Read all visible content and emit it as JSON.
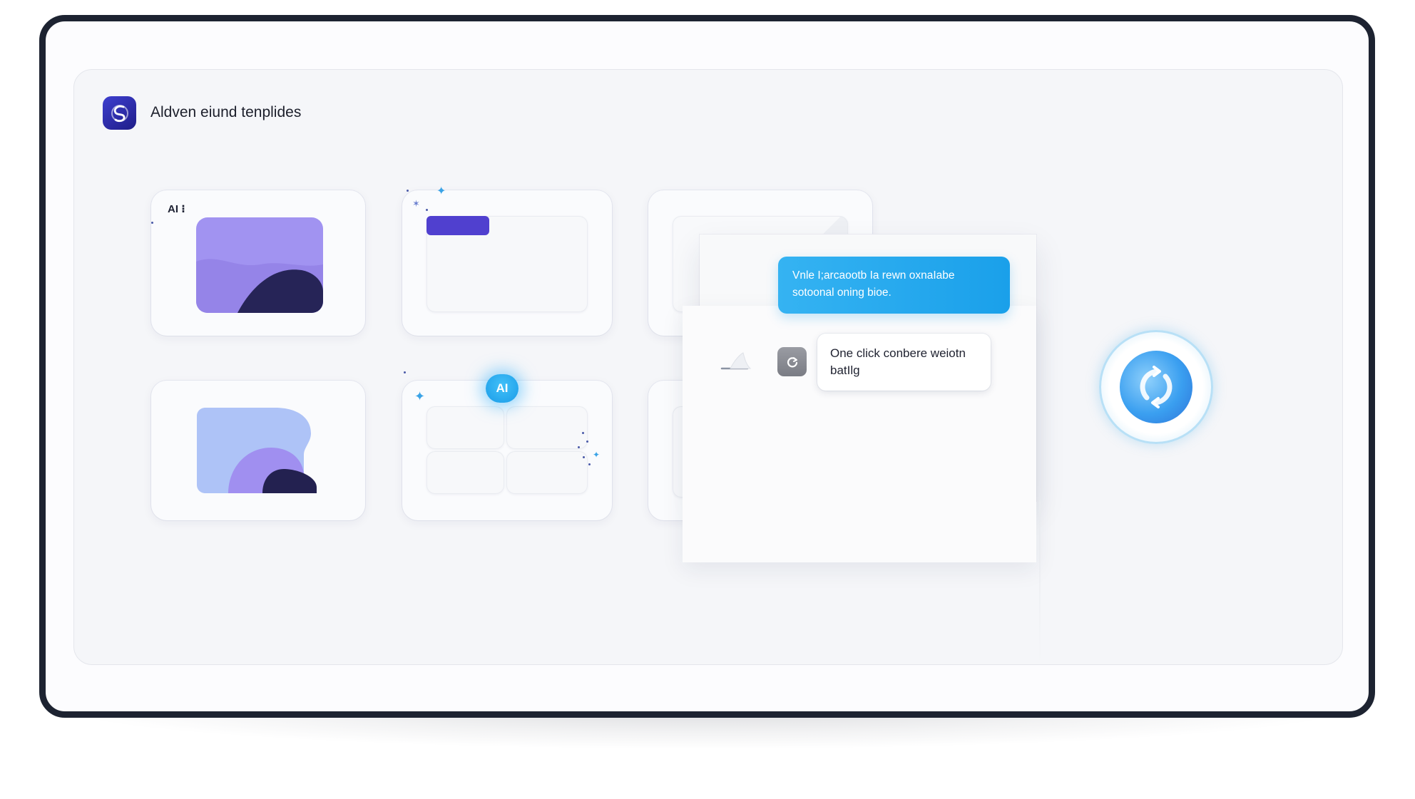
{
  "app": {
    "title": "Aldven eiund tenplides"
  },
  "template_grid": {
    "tile_1_badge": "AI ⁝"
  },
  "ai_badge": {
    "label": "AI"
  },
  "chat": {
    "ai_message": "Vnle I;arcaootb Ia rewn oxnaIabe sotoonal oning bioe.",
    "user_message": "One click conbere weiotn batIlg"
  },
  "icons": {
    "logo": "swirl-logo-icon",
    "user": "refresh-icon",
    "send": "paper-plane-icon",
    "sync": "sync-icon"
  },
  "colors": {
    "frame": "#1d2331",
    "brand": "#2d2bb4",
    "accent_blue": "#1aa0ea",
    "lavender": "#a193f1",
    "periwinkle": "#aec3f7",
    "navy_shape": "#262457",
    "indigo_bar": "#5040cf"
  }
}
